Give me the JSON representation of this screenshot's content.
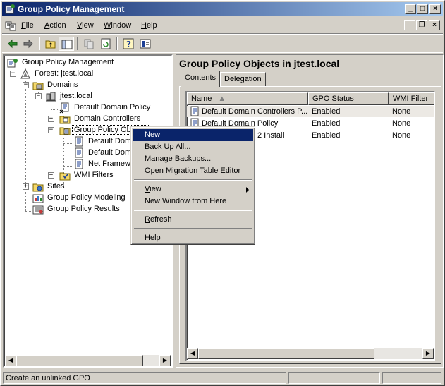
{
  "window": {
    "title": "Group Policy Management"
  },
  "menubar": {
    "items": [
      {
        "label": "File",
        "accel": "F",
        "rest": "ile"
      },
      {
        "label": "Action",
        "accel": "A",
        "rest": "ction"
      },
      {
        "label": "View",
        "accel": "V",
        "rest": "iew"
      },
      {
        "label": "Window",
        "accel": "W",
        "rest": "indow"
      },
      {
        "label": "Help",
        "accel": "H",
        "rest": "elp"
      }
    ]
  },
  "tree": {
    "items": [
      {
        "label": "Group Policy Management",
        "icon": "gpm-root-icon"
      },
      {
        "label": "Forest: jtest.local",
        "icon": "forest-icon"
      },
      {
        "label": "Domains",
        "icon": "domains-icon"
      },
      {
        "label": "jtest.local",
        "icon": "domain-icon"
      },
      {
        "label": "Default Domain Policy",
        "icon": "gpo-link-icon"
      },
      {
        "label": "Domain Controllers",
        "icon": "ou-icon"
      },
      {
        "label": "Group Policy Objects",
        "icon": "gpo-folder-icon"
      },
      {
        "label": "Default Doma",
        "icon": "gpo-icon"
      },
      {
        "label": "Default Doma",
        "icon": "gpo-icon"
      },
      {
        "label": "Net Framewo",
        "icon": "gpo-icon"
      },
      {
        "label": "WMI Filters",
        "icon": "wmi-folder-icon"
      },
      {
        "label": "Sites",
        "icon": "sites-icon"
      },
      {
        "label": "Group Policy Modeling",
        "icon": "modeling-icon"
      },
      {
        "label": "Group Policy Results",
        "icon": "results-icon"
      }
    ]
  },
  "right_pane": {
    "header": "Group Policy Objects in jtest.local",
    "tabs": [
      {
        "label": "Contents",
        "active": true
      },
      {
        "label": "Delegation",
        "active": false
      }
    ],
    "columns": [
      "Name",
      "GPO Status",
      "WMI Filter"
    ],
    "rows": [
      {
        "name": "Default Domain Controllers P...",
        "status": "Enabled",
        "wmi": "None"
      },
      {
        "name": "Default Domain Policy",
        "status": "Enabled",
        "wmi": "None"
      },
      {
        "name": "2 Install",
        "status": "Enabled",
        "wmi": "None"
      }
    ]
  },
  "context_menu": {
    "items": [
      {
        "label": "New",
        "accel": "N",
        "rest": "ew",
        "highlighted": true
      },
      {
        "label": "Back Up All...",
        "accel": "B",
        "rest": "ack Up All..."
      },
      {
        "label": "Manage Backups...",
        "accel": "M",
        "rest": "anage Backups..."
      },
      {
        "label": "Open Migration Table Editor",
        "accel": "O",
        "rest": "pen Migration Table Editor"
      },
      {
        "label": "View",
        "accel": "V",
        "rest": "iew",
        "submenu": true
      },
      {
        "label": "New Window from Here",
        "accel": "",
        "rest": "New Window from Here"
      },
      {
        "label": "Refresh",
        "accel": "R",
        "rest": "efresh"
      },
      {
        "label": "Help",
        "accel": "H",
        "rest": "elp"
      }
    ]
  },
  "statusbar": {
    "text": "Create an unlinked GPO"
  },
  "colors": {
    "title_gradient_start": "#0a246a",
    "title_gradient_end": "#a6caf0",
    "face": "#d4d0c8",
    "highlight": "#0a246a"
  }
}
